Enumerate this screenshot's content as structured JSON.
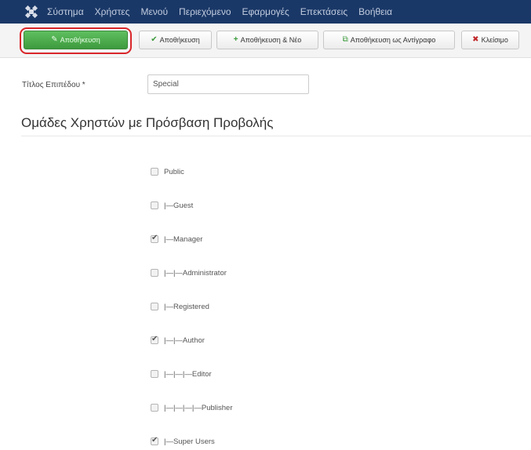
{
  "navbar": {
    "items": [
      "Σύστημα",
      "Χρήστες",
      "Μενού",
      "Περιεχόμενο",
      "Εφαρμογές",
      "Επεκτάσεις",
      "Βοήθεια"
    ]
  },
  "toolbar": {
    "save_label": "Αποθήκευση",
    "apply_label": "Αποθήκευση",
    "save_new_label": "Αποθήκευση & Νέο",
    "save_copy_label": "Αποθήκευση ως Αντίγραφο",
    "close_label": "Κλείσιμο"
  },
  "form": {
    "title_label": "Τίτλος Επιπέδου *",
    "title_value": "Special"
  },
  "section": {
    "heading": "Ομάδες Χρηστών με Πρόσβαση Προβολής"
  },
  "groups": [
    {
      "label": "Public",
      "checked": false
    },
    {
      "label": "|—Guest",
      "checked": false
    },
    {
      "label": "|—Manager",
      "checked": true
    },
    {
      "label": "|—|—Administrator",
      "checked": false
    },
    {
      "label": "|—Registered",
      "checked": false
    },
    {
      "label": "|—|—Author",
      "checked": true
    },
    {
      "label": "|—|—|—Editor",
      "checked": false
    },
    {
      "label": "|—|—|—|—Publisher",
      "checked": false
    },
    {
      "label": "|—Super Users",
      "checked": true
    }
  ],
  "colors": {
    "navbar": "#1a3867",
    "save_button": "#46a546",
    "highlight": "#d9262a"
  }
}
